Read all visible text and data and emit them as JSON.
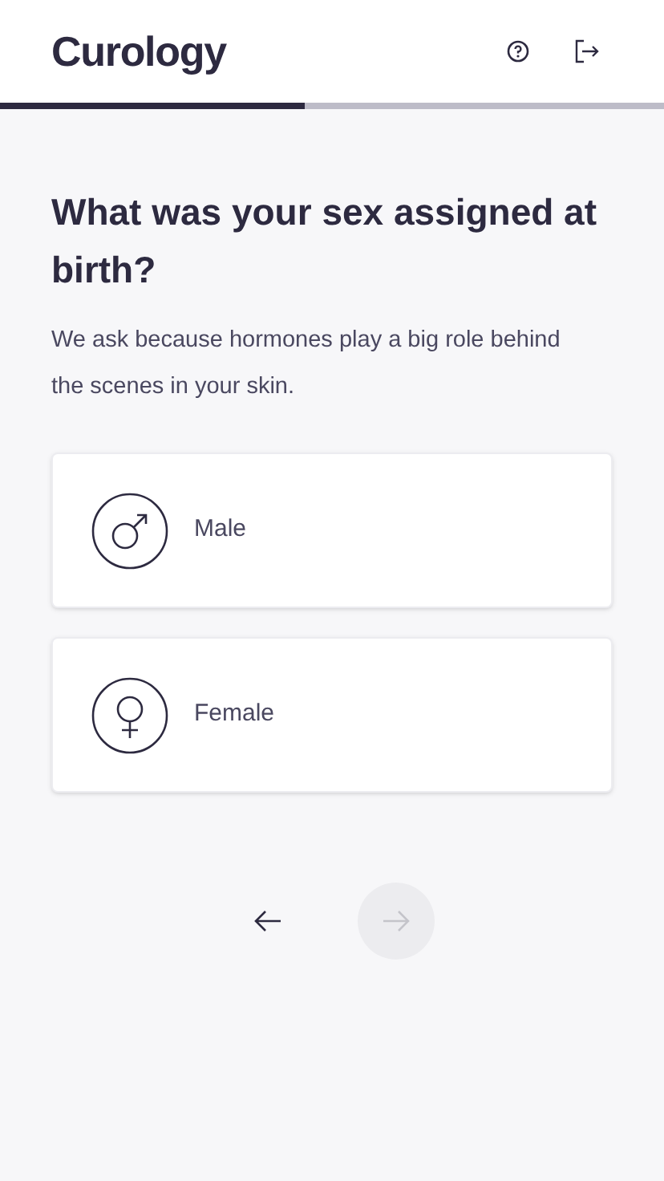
{
  "header": {
    "logo": "Curology"
  },
  "progress": {
    "level": 0.46
  },
  "question": {
    "title": "What was your sex assigned at birth?",
    "description": "We ask because hormones play a big role behind the scenes in your skin."
  },
  "options": [
    {
      "kind": "male",
      "label": "Male",
      "selected": false
    },
    {
      "kind": "female",
      "label": "Female",
      "selected": false
    }
  ],
  "navigation": {
    "next_disabled": true
  }
}
